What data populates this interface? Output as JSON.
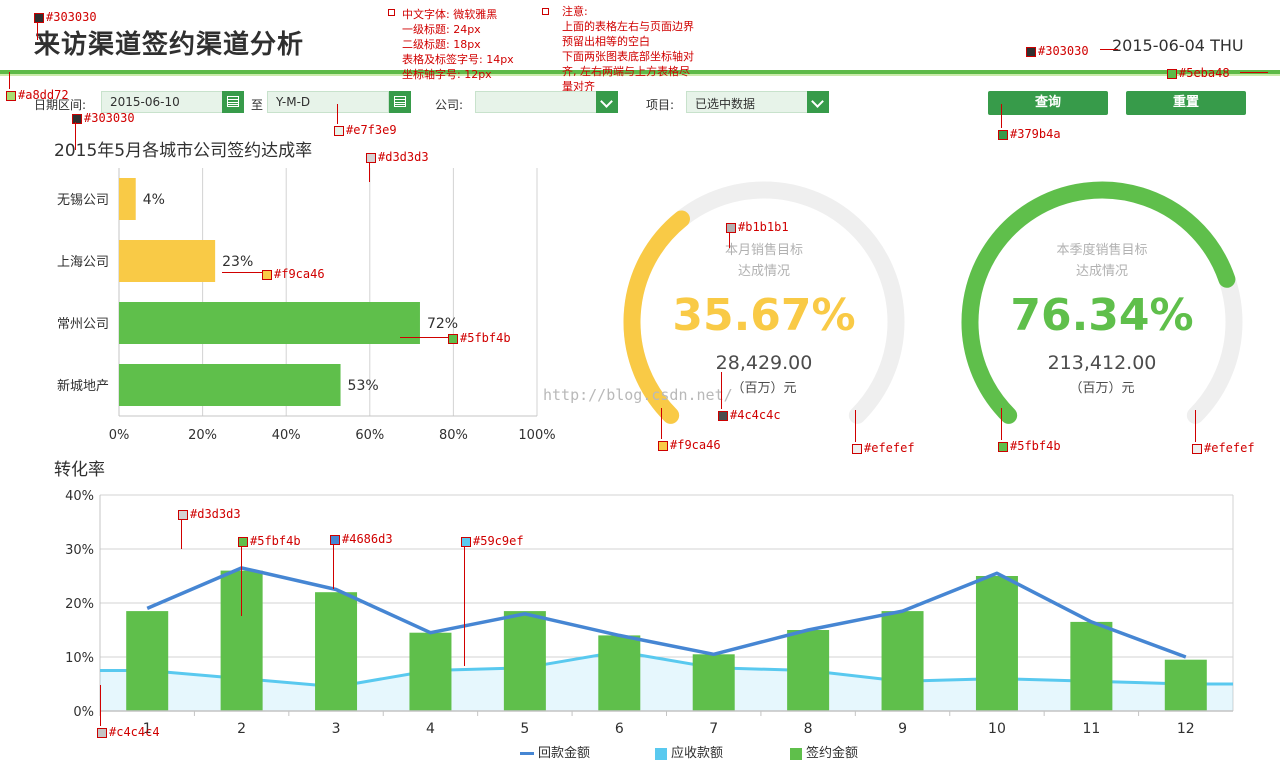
{
  "header": {
    "title": "来访渠道签约渠道分析",
    "date": "2015-06-04 THU"
  },
  "filters": {
    "date_range_label": "日期区间:",
    "date_start": "2015-06-10",
    "to_label": "至",
    "date_end_placeholder": "Y-M-D",
    "company_label": "公司:",
    "company_value": "",
    "project_label": "项目:",
    "project_value": "已选中数据",
    "query_button": "查询",
    "reset_button": "重置"
  },
  "style_notes": {
    "font_note": "中文字体: 微软雅黑\n一级标题: 24px\n二级标题: 18px\n表格及标签字号: 14px\n坐标轴字号: 12px",
    "layout_note": "注意:\n上面的表格左右与页面边界\n预留出相等的空白\n下面两张图表底部坐标轴对\n齐, 左右两端与上方表格尽\n量对齐"
  },
  "color_annotations": [
    {
      "id": "a1",
      "label": "#303030",
      "color": "#303030"
    },
    {
      "id": "a2",
      "label": "#303030",
      "color": "#303030"
    },
    {
      "id": "a3",
      "label": "#5eba48",
      "color": "#5eba48"
    },
    {
      "id": "a4",
      "label": "#a8dd72",
      "color": "#a8dd72"
    },
    {
      "id": "a5",
      "label": "#303030",
      "color": "#303030"
    },
    {
      "id": "a6",
      "label": "#e7f3e9",
      "color": "#e7f3e9"
    },
    {
      "id": "a7",
      "label": "#379b4a",
      "color": "#379b4a"
    },
    {
      "id": "a8",
      "label": "#d3d3d3",
      "color": "#d3d3d3"
    },
    {
      "id": "a9",
      "label": "#f9ca46",
      "color": "#f9ca46"
    },
    {
      "id": "a10",
      "label": "#5fbf4b",
      "color": "#5fbf4b"
    },
    {
      "id": "a11",
      "label": "#b1b1b1",
      "color": "#b1b1b1"
    },
    {
      "id": "a12",
      "label": "#4c4c4c",
      "color": "#4c4c4c"
    },
    {
      "id": "a13",
      "label": "#f9ca46",
      "color": "#f9ca46"
    },
    {
      "id": "a14",
      "label": "#efefef",
      "color": "#efefef"
    },
    {
      "id": "a15",
      "label": "#5fbf4b",
      "color": "#5fbf4b"
    },
    {
      "id": "a16",
      "label": "#efefef",
      "color": "#efefef"
    },
    {
      "id": "a17",
      "label": "#d3d3d3",
      "color": "#d3d3d3"
    },
    {
      "id": "a18",
      "label": "#5fbf4b",
      "color": "#5fbf4b"
    },
    {
      "id": "a19",
      "label": "#4686d3",
      "color": "#4686d3"
    },
    {
      "id": "a20",
      "label": "#59c9ef",
      "color": "#59c9ef"
    },
    {
      "id": "a21",
      "label": "#c4c4c4",
      "color": "#c4c4c4"
    }
  ],
  "watermark": "http://blog.csdn.net/",
  "bar_section_title": "2015年5月各城市公司签约达成率",
  "gauges": [
    {
      "title_line1": "本月销售目标",
      "title_line2": "达成情况",
      "percent_text": "35.67%",
      "percent": 35.67,
      "amount": "28,429.00",
      "unit": "（百万）元",
      "color": "#f9ca46",
      "track": "#efefef"
    },
    {
      "title_line1": "本季度销售目标",
      "title_line2": "达成情况",
      "percent_text": "76.34%",
      "percent": 76.34,
      "amount": "213,412.00",
      "unit": "（百万）元",
      "color": "#5fbf4b",
      "track": "#efefef"
    }
  ],
  "combo_section_title": "转化率",
  "chart_data": [
    {
      "type": "bar",
      "orientation": "horizontal",
      "title": "2015年5月各城市公司签约达成率",
      "categories": [
        "无锡公司",
        "上海公司",
        "常州公司",
        "新城地产"
      ],
      "values": [
        4,
        23,
        72,
        53
      ],
      "value_labels": [
        "4%",
        "23%",
        "72%",
        "53%"
      ],
      "colors": [
        "#f9ca46",
        "#f9ca46",
        "#5fbf4b",
        "#5fbf4b"
      ],
      "xlim": [
        0,
        100
      ],
      "xticks": [
        "0%",
        "20%",
        "40%",
        "60%",
        "80%",
        "100%"
      ],
      "grid": true
    },
    {
      "type": "bar",
      "title": "转化率",
      "categories": [
        "1",
        "2",
        "3",
        "4",
        "5",
        "6",
        "7",
        "8",
        "9",
        "10",
        "11",
        "12"
      ],
      "ylim": [
        0,
        40
      ],
      "yticks": [
        "0%",
        "10%",
        "20%",
        "30%",
        "40%"
      ],
      "grid": true,
      "legend_position": "bottom",
      "series": [
        {
          "name": "签约金额",
          "type": "bar",
          "color": "#5fbf4b",
          "values": [
            18.5,
            26,
            22,
            14.5,
            18.5,
            14,
            10.5,
            15,
            18.5,
            25,
            16.5,
            9.5
          ]
        },
        {
          "name": "回款金额",
          "type": "line",
          "color": "#4686d3",
          "values": [
            19,
            26.5,
            22.5,
            14.5,
            18,
            14,
            10.5,
            15,
            18.5,
            25.5,
            16.5,
            10
          ]
        },
        {
          "name": "应收款额",
          "type": "area",
          "color": "#59c9ef",
          "values": [
            7.5,
            6,
            4.5,
            7.5,
            8,
            11,
            8,
            7.5,
            5.5,
            6,
            5.5,
            5
          ]
        }
      ]
    }
  ]
}
